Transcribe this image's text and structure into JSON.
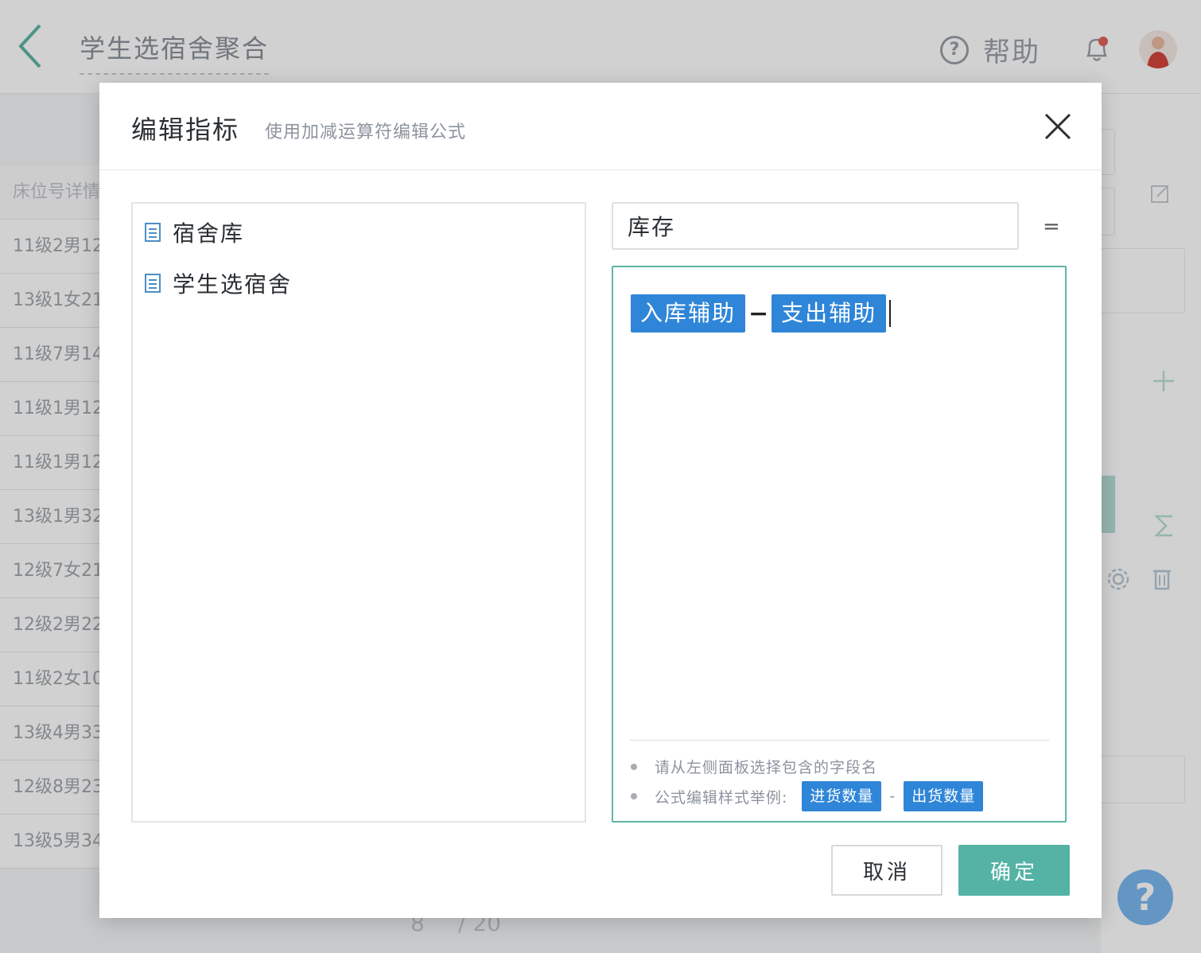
{
  "app": {
    "page_title": "学生选宿舍聚合",
    "help_label": "帮助",
    "help_glyph": "?",
    "float_help_glyph": "?"
  },
  "background_table": {
    "header": "床位号详情",
    "rows": [
      "11级2男12",
      "13级1女21",
      "11级7男14",
      "11级1男12",
      "11级1男12",
      "13级1男32",
      "12级7女21",
      "12级2男22",
      "11级2女10",
      "13级4男33",
      "12级8男23",
      "13级5男34"
    ]
  },
  "background_pager": {
    "page": "8",
    "total": "/ 20"
  },
  "dialog": {
    "title": "编辑指标",
    "subtitle": "使用加减运算符编辑公式",
    "tree": [
      {
        "label": "宿舍库",
        "icon": "document-icon"
      },
      {
        "label": "学生选宿舍",
        "icon": "document-icon"
      }
    ],
    "metric_name": "库存",
    "equals": "=",
    "formula": {
      "left": "入库辅助",
      "operator": "−",
      "right": "支出辅助"
    },
    "hints": {
      "line1": "请从左侧面板选择包含的字段名",
      "line2_prefix": "公式编辑样式举例:",
      "example_left": "进货数量",
      "example_operator": "-",
      "example_right": "出货数量"
    },
    "cancel_label": "取消",
    "ok_label": "确定"
  },
  "colors": {
    "accent_teal": "#55b3a5",
    "chip_blue": "#2f86d8",
    "formula_border": "#5fb4a8"
  }
}
